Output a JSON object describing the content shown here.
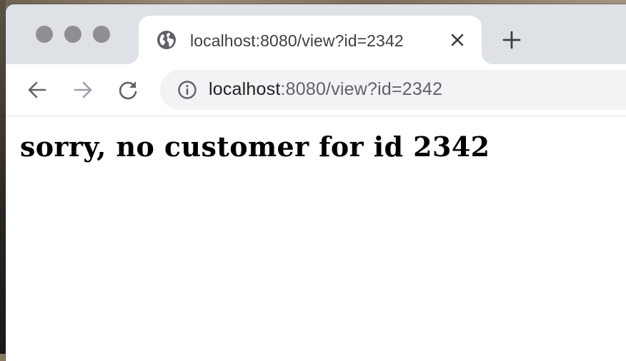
{
  "colors": {
    "tabstrip_bg": "#dee1e6",
    "omnibox_bg": "#f1f3f4",
    "icon_gray": "#5f6368",
    "icon_disabled": "#9aa0a6",
    "traffic_light": "#8e8f92"
  },
  "tab": {
    "title": "localhost:8080/view?id=2342",
    "favicon": "globe-icon",
    "close_icon": "close-icon"
  },
  "toolbar": {
    "back_icon": "arrow-left-icon",
    "forward_icon": "arrow-right-icon",
    "reload_icon": "reload-icon",
    "new_tab_icon": "plus-icon",
    "site_info_icon": "info-icon"
  },
  "address_bar": {
    "host": "localhost",
    "rest": ":8080/view?id=2342"
  },
  "page": {
    "message": "sorry, no customer for id 2342"
  }
}
